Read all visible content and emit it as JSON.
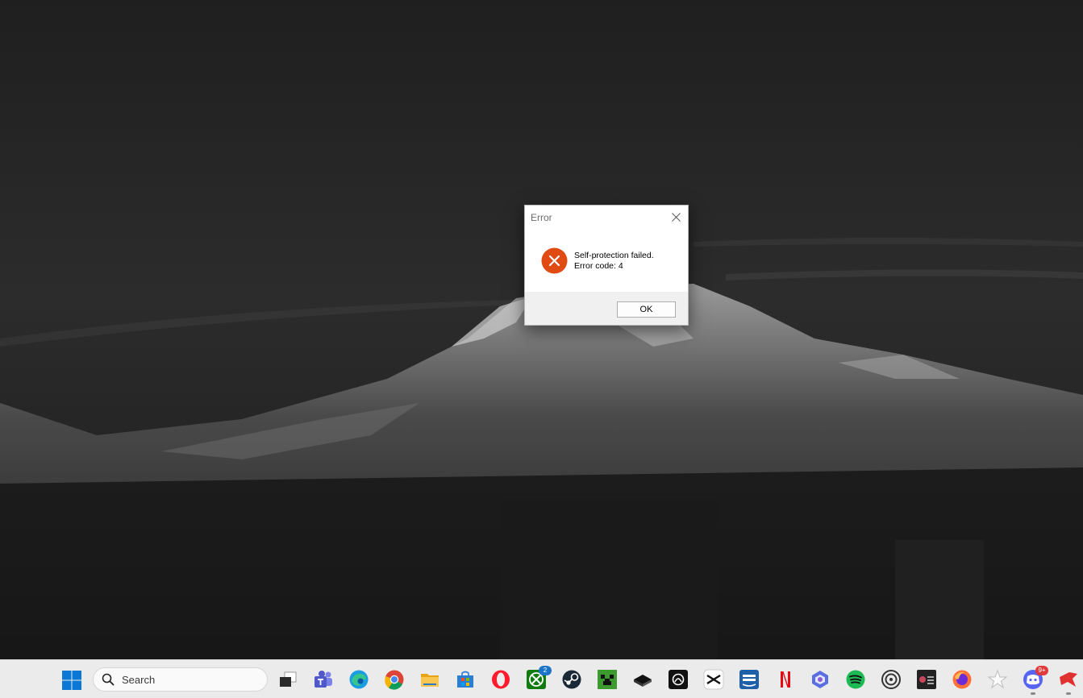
{
  "dialog": {
    "title": "Error",
    "message_line1": "Self-protection failed.",
    "message_line2": "Error code: 4",
    "ok_label": "OK"
  },
  "taskbar": {
    "search_placeholder": "Search",
    "badges": {
      "xbox": "2",
      "discord": "9+"
    }
  },
  "icons": [
    "windows-start-icon",
    "search-icon",
    "task-view-icon",
    "teams-icon",
    "edge-icon",
    "chrome-icon",
    "file-explorer-icon",
    "microsoft-store-icon",
    "opera-icon",
    "xbox-icon",
    "steam-icon",
    "minecraft-icon",
    "roblox-studio-icon",
    "chatgpt-icon",
    "capcut-icon",
    "prime-video-icon",
    "netflix-icon",
    "copilot-icon",
    "spotify-icon",
    "ubisoft-icon",
    "game-launcher-icon",
    "firefox-icon",
    "favorites-star-icon",
    "discord-icon",
    "tray-app-icon"
  ],
  "colors": {
    "error_icon": "#e04b14",
    "taskbar_bg": "#ebebeb",
    "badge_xbox": "#1b74c8",
    "badge_discord": "#e03b3b"
  }
}
